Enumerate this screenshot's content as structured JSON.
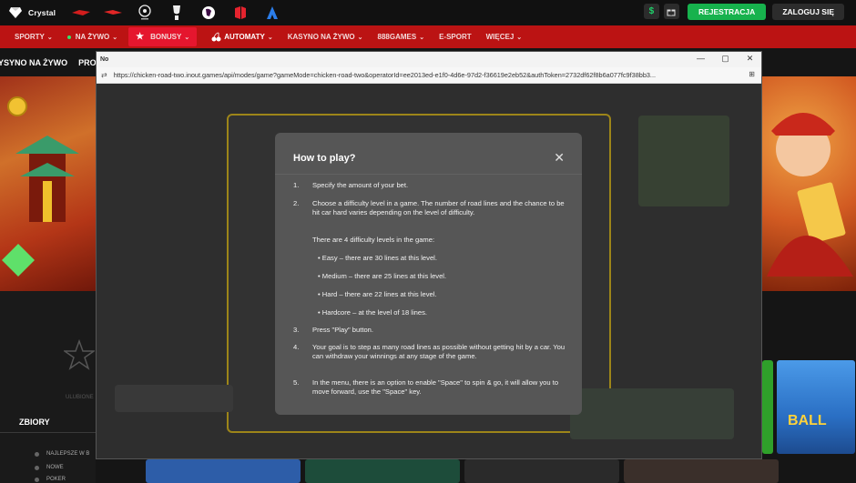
{
  "site": {
    "logo_text": "Crystal",
    "sponsors": [
      "sponsor-1-icon",
      "sponsor-2-icon",
      "champions-league-icon",
      "europa-league-icon",
      "premier-league-icon",
      "laliga-icon",
      "sponsor-7-icon"
    ],
    "dollar_icon": "$",
    "register_label": "REJESTRACJA",
    "login_label": "ZALOGUJ SIĘ"
  },
  "nav": {
    "items": [
      {
        "label": "SPORTY"
      },
      {
        "label": "NA ŻYWO"
      },
      {
        "label": "BONUSY"
      },
      {
        "label": "AUTOMATY"
      },
      {
        "label": "KASYNO NA ŻYWO"
      },
      {
        "label": "888GAMES"
      },
      {
        "label": "E-SPORT"
      },
      {
        "label": "WIĘCEJ"
      }
    ]
  },
  "subnav": {
    "item1": "YSYNO NA ŻYWO",
    "item2": "PROMO"
  },
  "sidebar": {
    "zbiory": "ZBIORY",
    "links": [
      "NAJLEPSZE W B",
      "NOWE",
      "POKER"
    ],
    "faded_label": "ULUBIONE"
  },
  "banner_right": {
    "ball_text": "BALL"
  },
  "browser": {
    "tab_label": "No",
    "url": "https://chicken-road-two.inout.games/api/modes/game?gameMode=chicken-road-two&operatorId=ee2013ed-e1f0-4d6e-97d2-f36619e2eb52&authToken=2732df62f8b6a077fc9f38bb3..."
  },
  "modal": {
    "title": "How to play?",
    "steps": [
      {
        "num": "1.",
        "text": "Specify the amount of your bet."
      },
      {
        "num": "2.",
        "text": "Choose a difficulty level in a game. The number of road lines and the chance to be hit car hard varies depending on the level of difficulty."
      },
      {
        "num": "3.",
        "text": "Press  \"Play\" button."
      },
      {
        "num": "4.",
        "text": "Your goal is to step as many road lines as possible without getting hit by a car. You can withdraw your winnings at any stage of the game."
      },
      {
        "num": "5.",
        "text": "In the menu, there is an option to enable \"Space\" to spin & go, it will allow you to move forward, use the \"Space\" key."
      }
    ],
    "levels_intro": "There are 4 difficulty levels in the game:",
    "levels": [
      "• Easy – there are 30 lines at this level.",
      "• Medium – there are 25 lines at this level.",
      "• Hard – there are 22 lines at this level.",
      "• Hardcore – at the level of 18 lines."
    ]
  }
}
